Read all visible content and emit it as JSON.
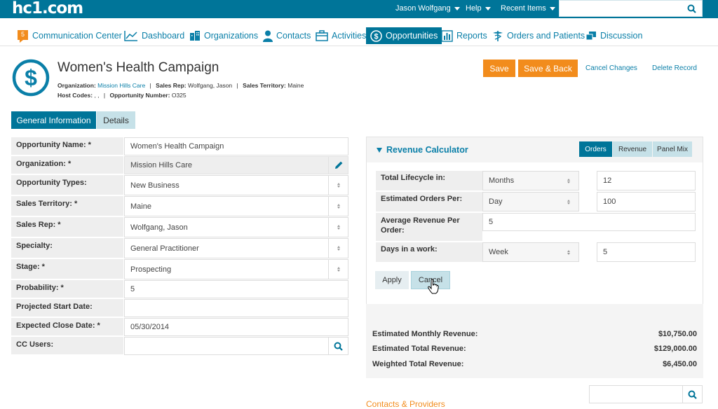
{
  "app": {
    "logo": "hc1.com"
  },
  "topbar": {
    "user": "Jason Wolfgang",
    "help": "Help",
    "recent": "Recent Items",
    "search_placeholder": ""
  },
  "nav": {
    "badge": "5",
    "items": [
      {
        "label": "Communication Center",
        "icon": "chat-icon"
      },
      {
        "label": "Dashboard",
        "icon": "chart-line-icon"
      },
      {
        "label": "Organizations",
        "icon": "building-icon"
      },
      {
        "label": "Contacts",
        "icon": "person-icon"
      },
      {
        "label": "Activities",
        "icon": "briefcase-icon"
      },
      {
        "label": "Opportunities",
        "icon": "dollar-icon",
        "active": true
      },
      {
        "label": "Reports",
        "icon": "bar-chart-icon"
      },
      {
        "label": "Orders and Patients",
        "icon": "caduceus-icon"
      },
      {
        "label": "Discussion",
        "icon": "discussion-icon"
      }
    ]
  },
  "record": {
    "title": "Women's Health Campaign",
    "org_label": "Organization:",
    "org_value": "Mission Hills Care",
    "rep_label": "Sales Rep:",
    "rep_value": "Wolfgang, Jason",
    "territory_label": "Sales Territory:",
    "territory_value": "Maine",
    "host_label": "Host Codes:",
    "host_value": ", ,",
    "opp_num_label": "Opportunity Number:",
    "opp_num_value": "O325",
    "sep": "|"
  },
  "actions": {
    "save": "Save",
    "save_back": "Save & Back",
    "cancel_changes": "Cancel Changes",
    "delete": "Delete Record"
  },
  "tabs": {
    "general": "General Information",
    "details": "Details"
  },
  "form": {
    "rows": [
      {
        "label": "Opportunity Name: *",
        "value": "Women's Health Campaign"
      },
      {
        "label": "Organization: *",
        "value": "Mission Hills Care"
      },
      {
        "label": "Opportunity Types:",
        "value": "New Business"
      },
      {
        "label": "Sales Territory: *",
        "value": "Maine"
      },
      {
        "label": "Sales Rep: *",
        "value": "Wolfgang, Jason"
      },
      {
        "label": "Specialty:",
        "value": "General Practitioner"
      },
      {
        "label": "Stage: *",
        "value": "Prospecting"
      },
      {
        "label": "Probability: *",
        "value": "5"
      },
      {
        "label": "Projected Start Date:",
        "value": ""
      },
      {
        "label": "Expected Close Date: *",
        "value": "05/30/2014"
      },
      {
        "label": "CC Users:",
        "value": ""
      }
    ]
  },
  "calculator": {
    "title": "Revenue Calculator",
    "tabs": [
      "Orders",
      "Revenue",
      "Panel Mix"
    ],
    "rows": [
      {
        "label": "Total Lifecycle in:",
        "unit": "Months",
        "value": "12"
      },
      {
        "label": "Estimated Orders Per:",
        "unit": "Day",
        "value": "100"
      },
      {
        "label": "Average Revenue Per Order:",
        "value": "5"
      },
      {
        "label": "Days in a work:",
        "unit": "Week",
        "value": "5"
      }
    ],
    "apply": "Apply",
    "cancel": "Cancel"
  },
  "totals": {
    "monthly_label": "Estimated Monthly Revenue:",
    "monthly_value": "$10,750.00",
    "total_label": "Estimated Total Revenue:",
    "total_value": "$129,000.00",
    "weighted_label": "Weighted Total Revenue:",
    "weighted_value": "$6,450.00"
  },
  "contacts": {
    "heading": "Contacts & Providers"
  },
  "colors": {
    "brand": "#007599",
    "accent": "#f28c1c",
    "link": "#0a7fa8"
  }
}
